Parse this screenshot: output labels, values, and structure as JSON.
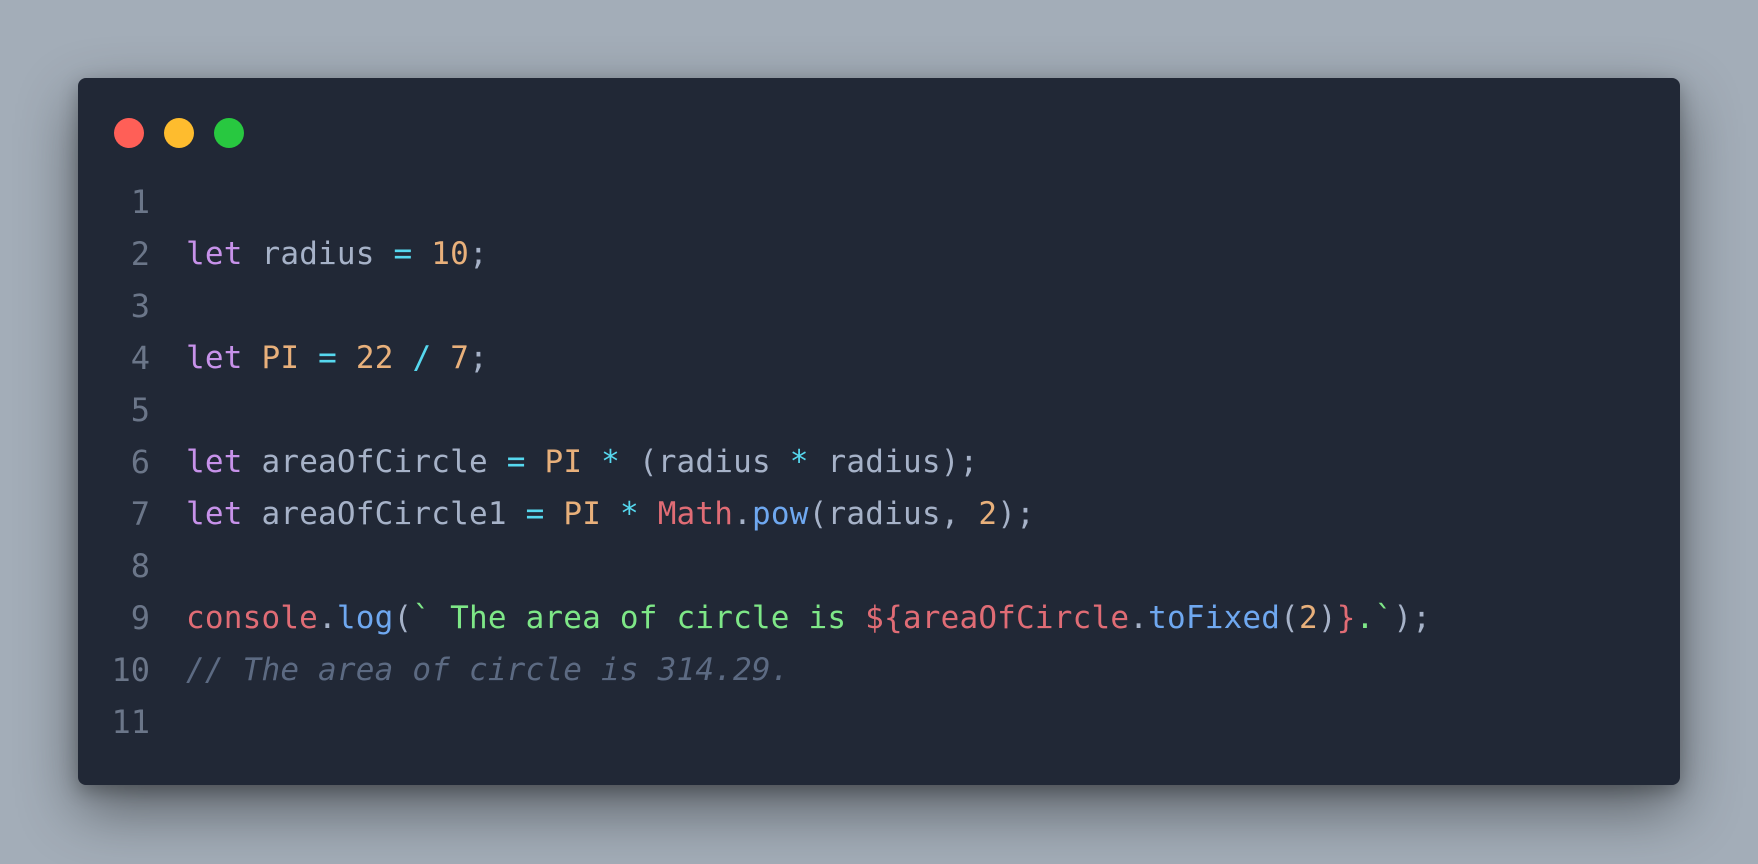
{
  "colors": {
    "background": "#a3adb8",
    "window": "#212836",
    "close": "#ff5f57",
    "minimize": "#febc2e",
    "maximize": "#28c840",
    "keyword": "#c792ea",
    "identifier": "#a6b2c8",
    "operator": "#56d8ef",
    "number": "#e8b07b",
    "object": "#e06c75",
    "function": "#6fa8f0",
    "string": "#7ee787",
    "comment": "#5c6a82",
    "line_number": "#6b7689"
  },
  "window_controls": [
    {
      "name": "close-icon",
      "color": "#ff5f57"
    },
    {
      "name": "minimize-icon",
      "color": "#febc2e"
    },
    {
      "name": "maximize-icon",
      "color": "#28c840"
    }
  ],
  "code_lines": [
    {
      "number": "1",
      "tokens": []
    },
    {
      "number": "2",
      "tokens": [
        {
          "t": "kw",
          "v": "let"
        },
        {
          "t": "pn",
          "v": " "
        },
        {
          "t": "id",
          "v": "radius"
        },
        {
          "t": "pn",
          "v": " "
        },
        {
          "t": "op",
          "v": "="
        },
        {
          "t": "pn",
          "v": " "
        },
        {
          "t": "num",
          "v": "10"
        },
        {
          "t": "pn",
          "v": ";"
        }
      ]
    },
    {
      "number": "3",
      "tokens": []
    },
    {
      "number": "4",
      "tokens": [
        {
          "t": "kw",
          "v": "let"
        },
        {
          "t": "pn",
          "v": " "
        },
        {
          "t": "num",
          "v": "PI"
        },
        {
          "t": "pn",
          "v": " "
        },
        {
          "t": "op",
          "v": "="
        },
        {
          "t": "pn",
          "v": " "
        },
        {
          "t": "num",
          "v": "22"
        },
        {
          "t": "pn",
          "v": " "
        },
        {
          "t": "op",
          "v": "/"
        },
        {
          "t": "pn",
          "v": " "
        },
        {
          "t": "num",
          "v": "7"
        },
        {
          "t": "pn",
          "v": ";"
        }
      ]
    },
    {
      "number": "5",
      "tokens": []
    },
    {
      "number": "6",
      "tokens": [
        {
          "t": "kw",
          "v": "let"
        },
        {
          "t": "pn",
          "v": " "
        },
        {
          "t": "id",
          "v": "areaOfCircle"
        },
        {
          "t": "pn",
          "v": " "
        },
        {
          "t": "op",
          "v": "="
        },
        {
          "t": "pn",
          "v": " "
        },
        {
          "t": "num",
          "v": "PI"
        },
        {
          "t": "pn",
          "v": " "
        },
        {
          "t": "op",
          "v": "*"
        },
        {
          "t": "pn",
          "v": " ("
        },
        {
          "t": "id",
          "v": "radius"
        },
        {
          "t": "pn",
          "v": " "
        },
        {
          "t": "op",
          "v": "*"
        },
        {
          "t": "pn",
          "v": " "
        },
        {
          "t": "id",
          "v": "radius"
        },
        {
          "t": "pn",
          "v": ");"
        }
      ]
    },
    {
      "number": "7",
      "tokens": [
        {
          "t": "kw",
          "v": "let"
        },
        {
          "t": "pn",
          "v": " "
        },
        {
          "t": "id",
          "v": "areaOfCircle1"
        },
        {
          "t": "pn",
          "v": " "
        },
        {
          "t": "op",
          "v": "="
        },
        {
          "t": "pn",
          "v": " "
        },
        {
          "t": "num",
          "v": "PI"
        },
        {
          "t": "pn",
          "v": " "
        },
        {
          "t": "op",
          "v": "*"
        },
        {
          "t": "pn",
          "v": " "
        },
        {
          "t": "obj",
          "v": "Math"
        },
        {
          "t": "pn",
          "v": "."
        },
        {
          "t": "fn",
          "v": "pow"
        },
        {
          "t": "pn",
          "v": "("
        },
        {
          "t": "id",
          "v": "radius"
        },
        {
          "t": "pn",
          "v": ", "
        },
        {
          "t": "num",
          "v": "2"
        },
        {
          "t": "pn",
          "v": ");"
        }
      ]
    },
    {
      "number": "8",
      "tokens": []
    },
    {
      "number": "9",
      "tokens": [
        {
          "t": "obj",
          "v": "console"
        },
        {
          "t": "pn",
          "v": "."
        },
        {
          "t": "fn",
          "v": "log"
        },
        {
          "t": "pn",
          "v": "("
        },
        {
          "t": "str",
          "v": "` The area of circle is "
        },
        {
          "t": "interp",
          "v": "${"
        },
        {
          "t": "obj",
          "v": "areaOfCircle"
        },
        {
          "t": "pn",
          "v": "."
        },
        {
          "t": "fn",
          "v": "toFixed"
        },
        {
          "t": "pn",
          "v": "("
        },
        {
          "t": "num",
          "v": "2"
        },
        {
          "t": "pn",
          "v": ")"
        },
        {
          "t": "interp",
          "v": "}"
        },
        {
          "t": "str",
          "v": ".`"
        },
        {
          "t": "pn",
          "v": ");"
        }
      ]
    },
    {
      "number": "10",
      "tokens": [
        {
          "t": "cmt",
          "v": "// The area of circle is 314.29."
        }
      ]
    },
    {
      "number": "11",
      "tokens": []
    }
  ]
}
